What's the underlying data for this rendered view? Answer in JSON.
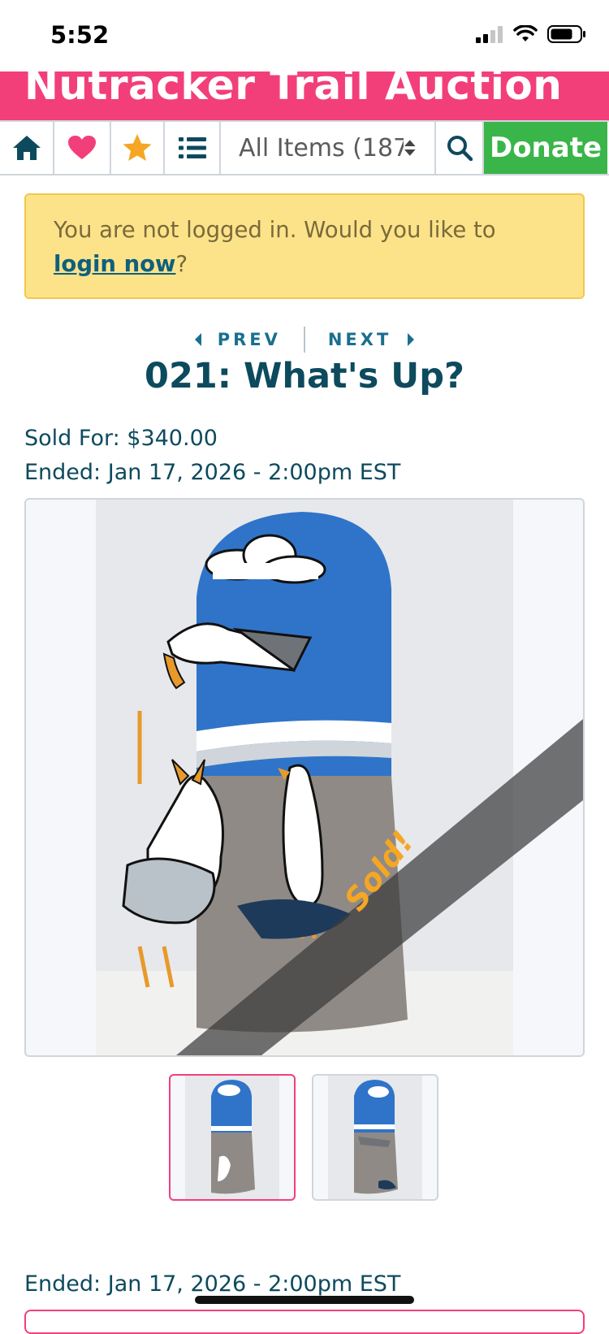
{
  "status": {
    "time": "5:52"
  },
  "header": {
    "title": "Nutracker Trail Auction"
  },
  "nav": {
    "select_value": "All Items (187",
    "donate_label": "Donate"
  },
  "alert": {
    "text_before": "You are not logged in. Would you like to ",
    "link_text": "login now",
    "text_after": "?"
  },
  "pager": {
    "prev_label": "PREV",
    "next_label": "NEXT"
  },
  "item": {
    "title": "021: What's Up?",
    "sold_for": "Sold For: $340.00",
    "ended": "Ended: Jan 17, 2026 - 2:00pm EST",
    "sold_ribbon": "Sold!"
  },
  "footer": {
    "ended": "Ended: Jan 17, 2026 - 2:00pm EST"
  },
  "colors": {
    "brand_pink": "#f23f7a",
    "donate_green": "#3ab54a",
    "alert_yellow": "#fce38a",
    "title_teal": "#0d4a5e",
    "sold_orange": "#f5a623"
  },
  "icons": [
    "home-icon",
    "heart-icon",
    "star-icon",
    "list-icon",
    "sort-caret-icon",
    "search-icon",
    "chevron-left-icon",
    "chevron-right-icon",
    "signal-icon",
    "wifi-icon",
    "battery-icon"
  ]
}
